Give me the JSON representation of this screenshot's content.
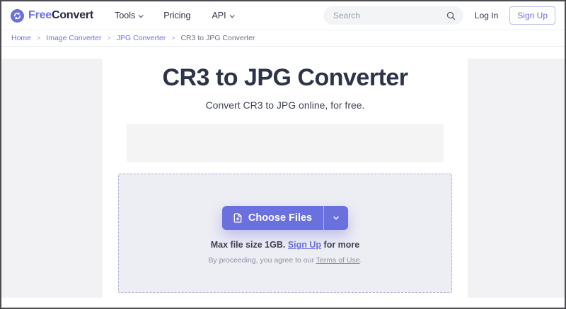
{
  "brand": {
    "name_free": "Free",
    "name_convert": "Convert",
    "logo_icon": "sync-circle-icon",
    "accent_color": "#6b70de"
  },
  "nav": {
    "items": [
      {
        "label": "Tools",
        "has_dropdown": true
      },
      {
        "label": "Pricing",
        "has_dropdown": false
      },
      {
        "label": "API",
        "has_dropdown": true
      }
    ]
  },
  "search": {
    "placeholder": "Search",
    "icon": "search-icon"
  },
  "auth": {
    "login_label": "Log In",
    "signup_label": "Sign Up"
  },
  "breadcrumb": {
    "separator": ">",
    "items": [
      {
        "label": "Home",
        "is_link": true
      },
      {
        "label": "Image Converter",
        "is_link": true
      },
      {
        "label": "JPG Converter",
        "is_link": true
      },
      {
        "label": "CR3 to JPG Converter",
        "is_link": false
      }
    ]
  },
  "main": {
    "title": "CR3 to JPG Converter",
    "subtitle": "Convert CR3 to JPG online, for free.",
    "uploader": {
      "choose_files_label": "Choose Files",
      "choose_files_icon": "file-plus-icon",
      "dropdown_icon": "chevron-down-icon",
      "max_size_prefix": "Max file size 1GB.",
      "signup_link_label": "Sign Up",
      "max_size_suffix": "for more",
      "terms_prefix": "By proceeding, you agree to our",
      "terms_link_label": "Terms of Use",
      "terms_suffix": "."
    }
  },
  "colors": {
    "accent": "#6b70de",
    "title_text": "#2d3348",
    "gutter_bg": "#f2f2f4",
    "upload_bg": "#ededf4",
    "upload_border": "#aeaed0"
  }
}
